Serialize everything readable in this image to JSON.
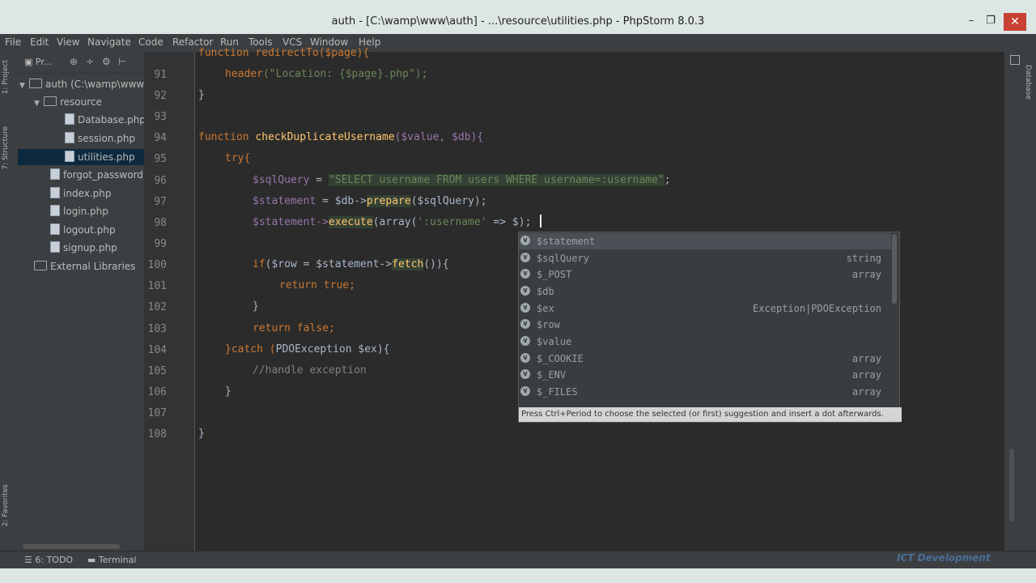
{
  "window": {
    "title": "auth - [C:\\wamp\\www\\auth] - ...\\resource\\utilities.php - PhpStorm 8.0.3",
    "minimize": "–",
    "maximize": "❐",
    "close": "✕"
  },
  "menu": [
    "File",
    "Edit",
    "View",
    "Navigate",
    "Code",
    "Refactor",
    "Run",
    "Tools",
    "VCS",
    "Window",
    "Help"
  ],
  "left_stripe": {
    "project_tab": "1: Project",
    "structure_tab": "7: Structure",
    "favorites_tab": "2: Favorites"
  },
  "project_panel": {
    "toolbar_label": "Pr...",
    "root": "auth (C:\\wamp\\www\\",
    "folder": "resource",
    "folder_files": [
      "Database.php",
      "session.php",
      "utilities.php"
    ],
    "root_files": [
      "forgot_password.",
      "index.php",
      "login.php",
      "logout.php",
      "signup.php"
    ],
    "external": "External Libraries"
  },
  "line_numbers": [
    "91",
    "92",
    "93",
    "94",
    "95",
    "96",
    "97",
    "98",
    "99",
    "100",
    "101",
    "102",
    "103",
    "104",
    "105",
    "106",
    "107",
    "108"
  ],
  "code": {
    "line90_partial": "function redirectTo($page){",
    "line91_kw": "header",
    "line91_rest": "(\"Location: {$page}.php\");",
    "line92": "}",
    "line94_kw": "function",
    "line94_fn": "checkDuplicateUsername",
    "line94_args": "($value, $db){",
    "line95": "try{",
    "line96_var": "$sqlQuery",
    "line96_eq": " = ",
    "line96_str": "\"SELECT username FROM users WHERE username=:username\"",
    "line96_end": ";",
    "line97_var": "$statement",
    "line97_mid": " = $db->",
    "line97_fn": "prepare",
    "line97_end": "($sqlQuery);",
    "line98_var": "$statement->",
    "line98_fn": "execute",
    "line98_mid": "(array(",
    "line98_str": "':username'",
    "line98_end": " => $);",
    "line100_kw": "if",
    "line100_mid": "($row = $statement->",
    "line100_fn": "fetch",
    "line100_end": "()){",
    "line101": "return true;",
    "line102": "}",
    "line103": "return false;",
    "line104_a": "}catch (",
    "line104_b": "PDOException $ex){",
    "line105": "//handle exception",
    "line106": "}",
    "line108": "}"
  },
  "completion": {
    "items": [
      {
        "name": "$statement",
        "type": ""
      },
      {
        "name": "$sqlQuery",
        "type": "string"
      },
      {
        "name": "$_POST",
        "type": "array"
      },
      {
        "name": "$db",
        "type": ""
      },
      {
        "name": "$ex",
        "type": "Exception|PDOException"
      },
      {
        "name": "$row",
        "type": ""
      },
      {
        "name": "$value",
        "type": ""
      },
      {
        "name": "$_COOKIE",
        "type": "array"
      },
      {
        "name": "$_ENV",
        "type": "array"
      },
      {
        "name": "$_FILES",
        "type": "array"
      }
    ],
    "hint": "Press Ctrl+Period to choose the selected (or first) suggestion and insert a dot afterwards."
  },
  "right_stripe": {
    "database_tab": "Database"
  },
  "bottom": {
    "todo": "6: TODO",
    "terminal": "Terminal"
  },
  "watermark": "ICT Development"
}
